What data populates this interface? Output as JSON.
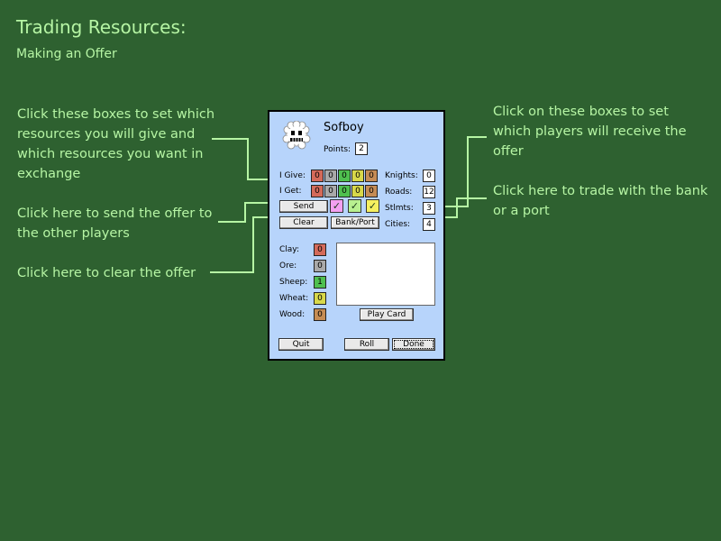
{
  "page": {
    "title": "Trading Resources:",
    "subtitle": "Making an Offer"
  },
  "notes": {
    "left1": "Click these boxes to set which resources you will give and which resources you want in exchange",
    "left2": "Click here to send the offer to the other players",
    "left3": "Click here to clear the offer",
    "right1": "Click on these boxes to set which players will receive the offer",
    "right2": "Click here to trade with the bank or a port"
  },
  "player": {
    "name": "Sofboy",
    "points_label": "Points:",
    "points": "2",
    "avatar_icon": "smiley-face-icon"
  },
  "trade": {
    "give_label": "I Give:",
    "get_label": "I Get:",
    "give_values": [
      "0",
      "0",
      "0",
      "0",
      "0"
    ],
    "get_values": [
      "0",
      "0",
      "0",
      "0",
      "0"
    ],
    "resource_colors": [
      "#d46a5a",
      "#a9a9a9",
      "#4fc04f",
      "#d8d84a",
      "#c58c54"
    ]
  },
  "stats": {
    "knights_label": "Knights:",
    "knights": "0",
    "roads_label": "Roads:",
    "roads": "12",
    "stlmts_label": "Stlmts:",
    "stlmts": "3",
    "cities_label": "Cities:",
    "cities": "4"
  },
  "buttons": {
    "send": "Send",
    "clear": "Clear",
    "bank_port": "Bank/Port",
    "play_card": "Play Card",
    "quit": "Quit",
    "roll": "Roll",
    "done": "Done"
  },
  "receivers": {
    "colors": [
      "#f3a0f0",
      "#b8f090",
      "#f6f060"
    ],
    "checked": [
      true,
      true,
      true
    ],
    "check_icon": "checkmark-icon"
  },
  "resources": [
    {
      "label": "Clay:",
      "value": "0",
      "color": "#d46a5a"
    },
    {
      "label": "Ore:",
      "value": "0",
      "color": "#a9a9a9"
    },
    {
      "label": "Sheep:",
      "value": "1",
      "color": "#4fc04f"
    },
    {
      "label": "Wheat:",
      "value": "0",
      "color": "#d8d84a"
    },
    {
      "label": "Wood:",
      "value": "0",
      "color": "#c58c54"
    }
  ],
  "theme": {
    "background": "#2e6130",
    "text": "#b6f5a4",
    "panel": "#b7d4fb"
  }
}
